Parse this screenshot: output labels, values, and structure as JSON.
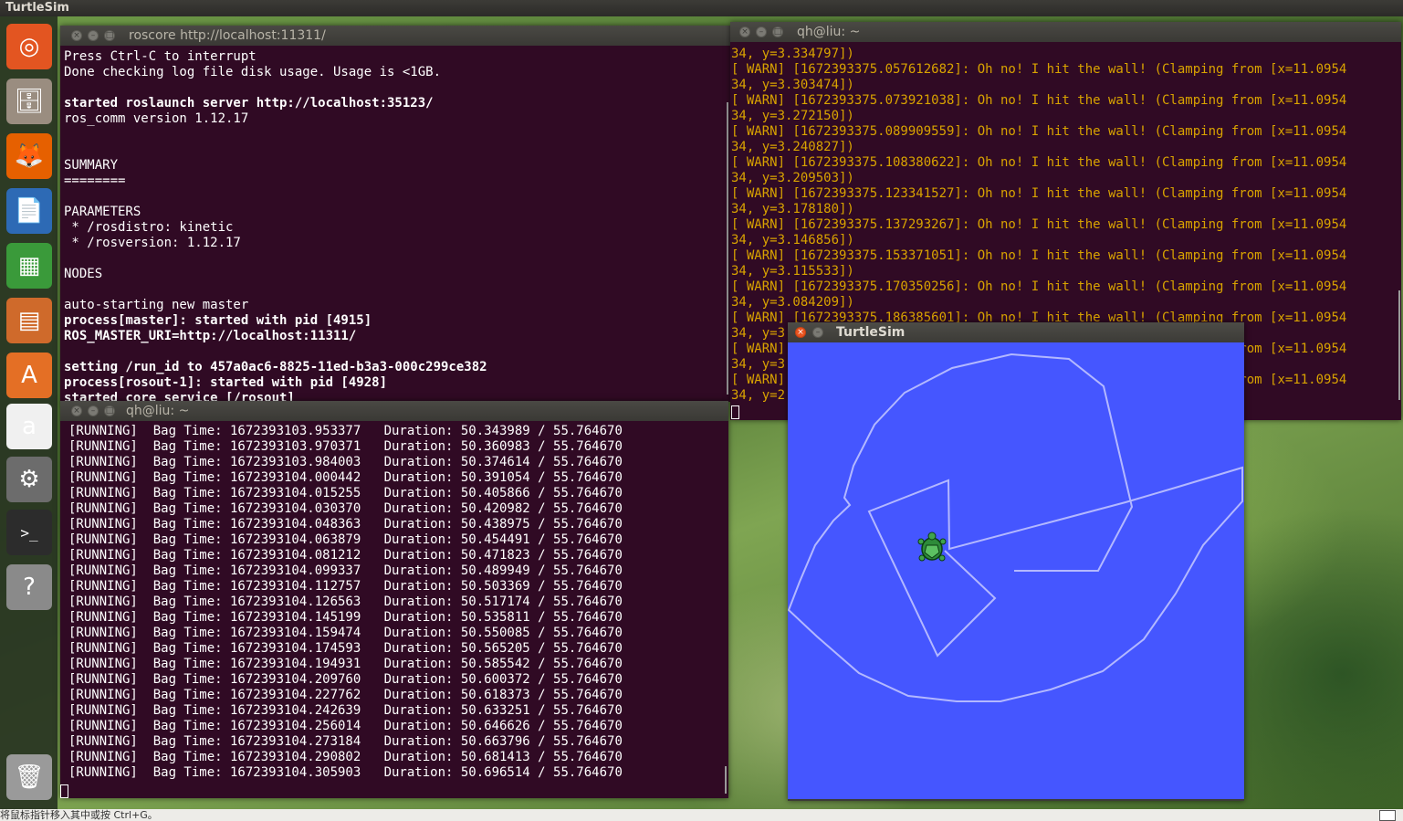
{
  "topbar": {
    "app_title": "TurtleSim"
  },
  "launcher": {
    "items": [
      {
        "name": "ubuntu-dash-icon",
        "glyph": "◎",
        "color": "#e35521"
      },
      {
        "name": "files-icon",
        "glyph": "🗄",
        "color": "#9a8d80"
      },
      {
        "name": "firefox-icon",
        "glyph": "🦊",
        "color": "#e66000"
      },
      {
        "name": "writer-icon",
        "glyph": "📄",
        "color": "#2d6ab5"
      },
      {
        "name": "calc-icon",
        "glyph": "▦",
        "color": "#3a9a3a"
      },
      {
        "name": "impress-icon",
        "glyph": "▤",
        "color": "#cf6a2b"
      },
      {
        "name": "software-center-icon",
        "glyph": "A",
        "color": "#e46f25"
      },
      {
        "name": "amazon-icon",
        "glyph": "a",
        "color": "#f0f0f0"
      },
      {
        "name": "system-settings-icon",
        "glyph": "⚙",
        "color": "#6c6c6c"
      },
      {
        "name": "terminal-icon",
        "glyph": ">_",
        "color": "#2c2c2c"
      },
      {
        "name": "help-icon",
        "glyph": "?",
        "color": "#8a8a8a"
      },
      {
        "name": "trash-icon",
        "glyph": "🗑",
        "color": "#9a9a9a"
      }
    ]
  },
  "roscore_window": {
    "title": "roscore http://localhost:11311/",
    "lines": [
      {
        "text": "Press Ctrl-C to interrupt",
        "bold": false
      },
      {
        "text": "Done checking log file disk usage. Usage is <1GB.",
        "bold": false
      },
      {
        "text": "",
        "bold": false
      },
      {
        "text": "started roslaunch server http://localhost:35123/",
        "bold": true
      },
      {
        "text": "ros_comm version 1.12.17",
        "bold": false
      },
      {
        "text": "",
        "bold": false
      },
      {
        "text": "",
        "bold": false
      },
      {
        "text": "SUMMARY",
        "bold": false
      },
      {
        "text": "========",
        "bold": false
      },
      {
        "text": "",
        "bold": false
      },
      {
        "text": "PARAMETERS",
        "bold": false
      },
      {
        "text": " * /rosdistro: kinetic",
        "bold": false
      },
      {
        "text": " * /rosversion: 1.12.17",
        "bold": false
      },
      {
        "text": "",
        "bold": false
      },
      {
        "text": "NODES",
        "bold": false
      },
      {
        "text": "",
        "bold": false
      },
      {
        "text": "auto-starting new master",
        "bold": false
      },
      {
        "text": "process[master]: started with pid [4915]",
        "bold": true
      },
      {
        "text": "ROS_MASTER_URI=http://localhost:11311/",
        "bold": true
      },
      {
        "text": "",
        "bold": false
      },
      {
        "text": "setting /run_id to 457a0ac6-8825-11ed-b3a3-000c299ce382",
        "bold": true
      },
      {
        "text": "process[rosout-1]: started with pid [4928]",
        "bold": true
      },
      {
        "text": "started core service [/rosout]",
        "bold": true
      }
    ]
  },
  "warn_window": {
    "title": "qh@liu: ~",
    "lines": [
      "34, y=3.334797])",
      "[ WARN] [1672393375.057612682]: Oh no! I hit the wall! (Clamping from [x=11.0954",
      "34, y=3.303474])",
      "[ WARN] [1672393375.073921038]: Oh no! I hit the wall! (Clamping from [x=11.0954",
      "34, y=3.272150])",
      "[ WARN] [1672393375.089909559]: Oh no! I hit the wall! (Clamping from [x=11.0954",
      "34, y=3.240827])",
      "[ WARN] [1672393375.108380622]: Oh no! I hit the wall! (Clamping from [x=11.0954",
      "34, y=3.209503])",
      "[ WARN] [1672393375.123341527]: Oh no! I hit the wall! (Clamping from [x=11.0954",
      "34, y=3.178180])",
      "[ WARN] [1672393375.137293267]: Oh no! I hit the wall! (Clamping from [x=11.0954",
      "34, y=3.146856])",
      "[ WARN] [1672393375.153371051]: Oh no! I hit the wall! (Clamping from [x=11.0954",
      "34, y=3.115533])",
      "[ WARN] [1672393375.170350256]: Oh no! I hit the wall! (Clamping from [x=11.0954",
      "34, y=3.084209])",
      "[ WARN] [1672393375.186385601]: Oh no! I hit the wall! (Clamping from [x=11.0954",
      "34, y=3.052886])",
      "[ WARN] [1672393375.202398413]: Oh no! I hit the wall! (Clamping from [x=11.0954",
      "34, y=3.021562])",
      "[ WARN] [1672393375.218391047]: Oh no! I hit the wall! (Clamping from [x=11.0954",
      "34, y=2.990239])"
    ]
  },
  "bag_window": {
    "title": "qh@liu: ~",
    "lines": [
      "[RUNNING]  Bag Time: 1672393103.953377   Duration: 50.343989 / 55.764670",
      "[RUNNING]  Bag Time: 1672393103.970371   Duration: 50.360983 / 55.764670",
      "[RUNNING]  Bag Time: 1672393103.984003   Duration: 50.374614 / 55.764670",
      "[RUNNING]  Bag Time: 1672393104.000442   Duration: 50.391054 / 55.764670",
      "[RUNNING]  Bag Time: 1672393104.015255   Duration: 50.405866 / 55.764670",
      "[RUNNING]  Bag Time: 1672393104.030370   Duration: 50.420982 / 55.764670",
      "[RUNNING]  Bag Time: 1672393104.048363   Duration: 50.438975 / 55.764670",
      "[RUNNING]  Bag Time: 1672393104.063879   Duration: 50.454491 / 55.764670",
      "[RUNNING]  Bag Time: 1672393104.081212   Duration: 50.471823 / 55.764670",
      "[RUNNING]  Bag Time: 1672393104.099337   Duration: 50.489949 / 55.764670",
      "[RUNNING]  Bag Time: 1672393104.112757   Duration: 50.503369 / 55.764670",
      "[RUNNING]  Bag Time: 1672393104.126563   Duration: 50.517174 / 55.764670",
      "[RUNNING]  Bag Time: 1672393104.145199   Duration: 50.535811 / 55.764670",
      "[RUNNING]  Bag Time: 1672393104.159474   Duration: 50.550085 / 55.764670",
      "[RUNNING]  Bag Time: 1672393104.174593   Duration: 50.565205 / 55.764670",
      "[RUNNING]  Bag Time: 1672393104.194931   Duration: 50.585542 / 55.764670",
      "[RUNNING]  Bag Time: 1672393104.209760   Duration: 50.600372 / 55.764670",
      "[RUNNING]  Bag Time: 1672393104.227762   Duration: 50.618373 / 55.764670",
      "[RUNNING]  Bag Time: 1672393104.242639   Duration: 50.633251 / 55.764670",
      "[RUNNING]  Bag Time: 1672393104.256014   Duration: 50.646626 / 55.764670",
      "[RUNNING]  Bag Time: 1672393104.273184   Duration: 50.663796 / 55.764670",
      "[RUNNING]  Bag Time: 1672393104.290802   Duration: 50.681413 / 55.764670",
      "[RUNNING]  Bag Time: 1672393104.305903   Duration: 50.696514 / 55.764670"
    ]
  },
  "turtlesim_window": {
    "title": "TurtleSim",
    "background_color": "#4556ff",
    "path_color": "#b3b8ff"
  },
  "statusbar": {
    "hint": "将鼠标指针移入其中或按 Ctrl+G。"
  },
  "colors": {
    "terminal_bg": "#300a24",
    "warn_text": "#d9a300",
    "accent": "#e95420"
  }
}
